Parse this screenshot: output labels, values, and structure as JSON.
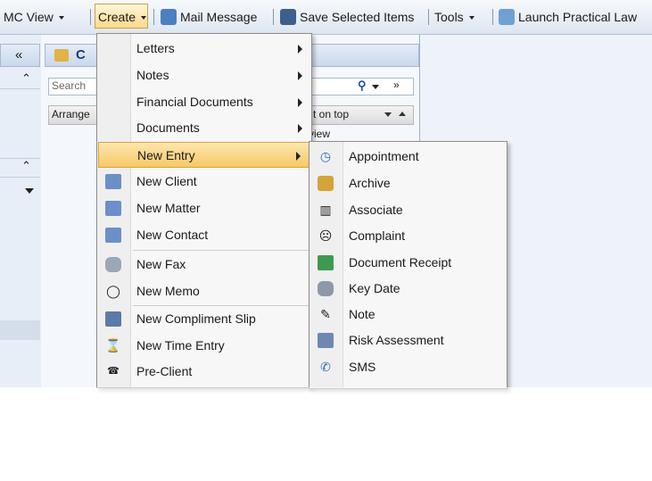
{
  "toolbar": {
    "mc_view": "MC View",
    "create": "Create",
    "mail_message": "Mail Message",
    "save_selected_items": "Save Selected Items",
    "tools": "Tools",
    "launch": "Launch Practical Law"
  },
  "background": {
    "search_placeholder": "Search",
    "arrange": "Arrange",
    "sort_label": "t on top",
    "view_label": "view",
    "double_left": "«",
    "collapse": "⌃",
    "folder_letter": "C"
  },
  "create_menu": {
    "letters": "Letters",
    "notes": "Notes",
    "financial_documents": "Financial Documents",
    "documents": "Documents",
    "new_entry": "New Entry",
    "new_client": "New Client",
    "new_matter": "New Matter",
    "new_contact": "New Contact",
    "new_fax": "New Fax",
    "new_memo": "New Memo",
    "new_compliment_slip": "New Compliment Slip",
    "new_time_entry": "New Time Entry",
    "pre_client": "Pre-Client"
  },
  "new_entry_menu": {
    "appointment": "Appointment",
    "archive": "Archive",
    "associate": "Associate",
    "complaint": "Complaint",
    "document_receipt": "Document Receipt",
    "key_date": "Key Date",
    "note": "Note",
    "risk_assessment": "Risk Assessment",
    "sms": "SMS"
  },
  "colors": {
    "highlight": "#f7c865",
    "toolbar": "#dde6f1",
    "menu_bg": "#f7f7f7"
  }
}
